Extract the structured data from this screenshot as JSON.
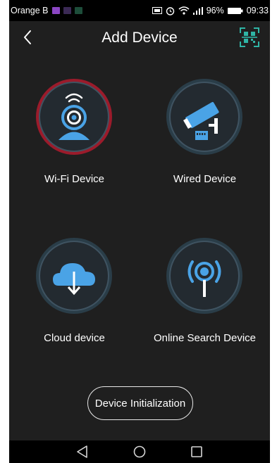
{
  "status_bar": {
    "carrier": "Orange B",
    "battery": "96%",
    "time": "09:33"
  },
  "header": {
    "title": "Add Device"
  },
  "options": [
    {
      "label": "Wi-Fi Device",
      "icon": "wifi-camera-icon"
    },
    {
      "label": "Wired Device",
      "icon": "wired-camera-icon"
    },
    {
      "label": "Cloud device",
      "icon": "cloud-download-icon"
    },
    {
      "label": "Online Search Device",
      "icon": "broadcast-antenna-icon"
    }
  ],
  "actions": {
    "init_label": "Device Initialization"
  },
  "colors": {
    "background": "#1f1f1f",
    "accent_blue": "#4aa3e6",
    "selected_ring": "#9b1b2b"
  }
}
